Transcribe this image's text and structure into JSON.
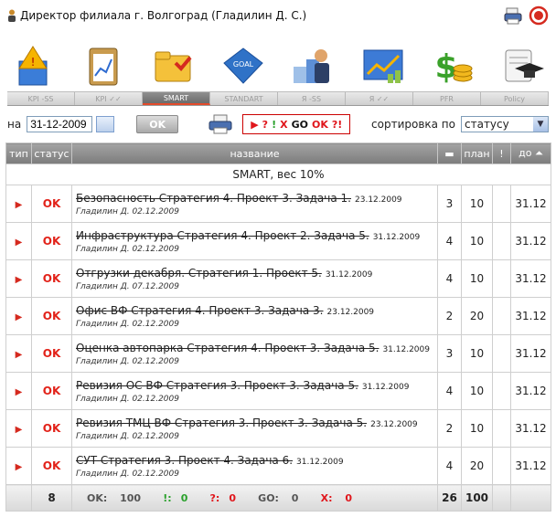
{
  "header": {
    "title": "Директор филиала г. Волгоград  (Гладилин Д. С.)"
  },
  "app_icons": [
    "kpi-bundle-icon",
    "kpi-clipboard-icon",
    "smart-folder-icon",
    "goal-icon",
    "ranking-icon",
    "chart-icon",
    "money-icon",
    "policy-icon"
  ],
  "tabs": [
    {
      "label": "KPI -SS",
      "active": false
    },
    {
      "label": "KPI ✓✓",
      "active": false
    },
    {
      "label": "SMART",
      "active": true
    },
    {
      "label": "STANDART",
      "active": false
    },
    {
      "label": "Я -SS",
      "active": false
    },
    {
      "label": "Я ✓✓",
      "active": false
    },
    {
      "label": "PFR",
      "active": false
    },
    {
      "label": "Policy",
      "active": false
    }
  ],
  "toolbar": {
    "na_label": "на",
    "date_value": "31-12-2009",
    "ok_label": "OK",
    "filter": {
      "tri": "▶",
      "q": "?",
      "ex": "!",
      "x": "X",
      "go": "GO",
      "ok": "OK",
      "qex": "?!"
    },
    "sort_label": "сортировка по",
    "sort_value": "статусу"
  },
  "table": {
    "headers": {
      "type": "тип",
      "status": "статус",
      "name": "название",
      "comment": "",
      "plan": "план",
      "flag": "!",
      "due": "до ⏶"
    },
    "section_title": "SMART, вес 10%",
    "rows": [
      {
        "status": "OK",
        "name": "Безопасность Стратегия 4. Проект 3. Задача 1.",
        "date": "23.12.2009",
        "author": "Гладилин Д. 02.12.2009",
        "comments": "3",
        "plan": "10",
        "due": "31.12"
      },
      {
        "status": "OK",
        "name": "Инфраструктура Стратегия 4. Проект 2. Задача 5.",
        "date": "31.12.2009",
        "author": "Гладилин Д. 02.12.2009",
        "comments": "4",
        "plan": "10",
        "due": "31.12"
      },
      {
        "status": "OK",
        "name": "Отгрузки декабря. Стратегия 1. Проект 5.",
        "date": "31.12.2009",
        "author": "Гладилин Д. 07.12.2009",
        "comments": "4",
        "plan": "10",
        "due": "31.12"
      },
      {
        "status": "OK",
        "name": "Офис ВФ Стратегия 4. Проект 3. Задача 3.",
        "date": "23.12.2009",
        "author": "Гладилин Д. 02.12.2009",
        "comments": "2",
        "plan": "20",
        "due": "31.12"
      },
      {
        "status": "OK",
        "name": "Оценка автопарка Стратегия 4. Проект 3. Задача 5.",
        "date": "31.12.2009",
        "author": "Гладилин Д. 02.12.2009",
        "comments": "3",
        "plan": "10",
        "due": "31.12"
      },
      {
        "status": "OK",
        "name": "Ревизия ОС ВФ Стратегия 3. Проект 3. Задача 5.",
        "date": "31.12.2009",
        "author": "Гладилин Д. 02.12.2009",
        "comments": "4",
        "plan": "10",
        "due": "31.12"
      },
      {
        "status": "OK",
        "name": "Ревизия ТМЦ ВФ Стратегия 3. Проект 3. Задача 5.",
        "date": "23.12.2009",
        "author": "Гладилин Д. 02.12.2009",
        "comments": "2",
        "plan": "10",
        "due": "31.12"
      },
      {
        "status": "OK",
        "name": "СУТ Стратегия 3. Проект 4. Задача 6.",
        "date": "31.12.2009",
        "author": "Гладилин Д. 02.12.2009",
        "comments": "4",
        "plan": "20",
        "due": "31.12"
      }
    ],
    "footer": {
      "count": "8",
      "ok_label": "OK:",
      "ok_val": "100",
      "ex_label": "!:",
      "ex_val": "0",
      "q_label": "?:",
      "q_val": "0",
      "go_label": "GO:",
      "go_val": "0",
      "x_label": "X:",
      "x_val": "0",
      "comments_total": "26",
      "plan_total": "100"
    }
  }
}
